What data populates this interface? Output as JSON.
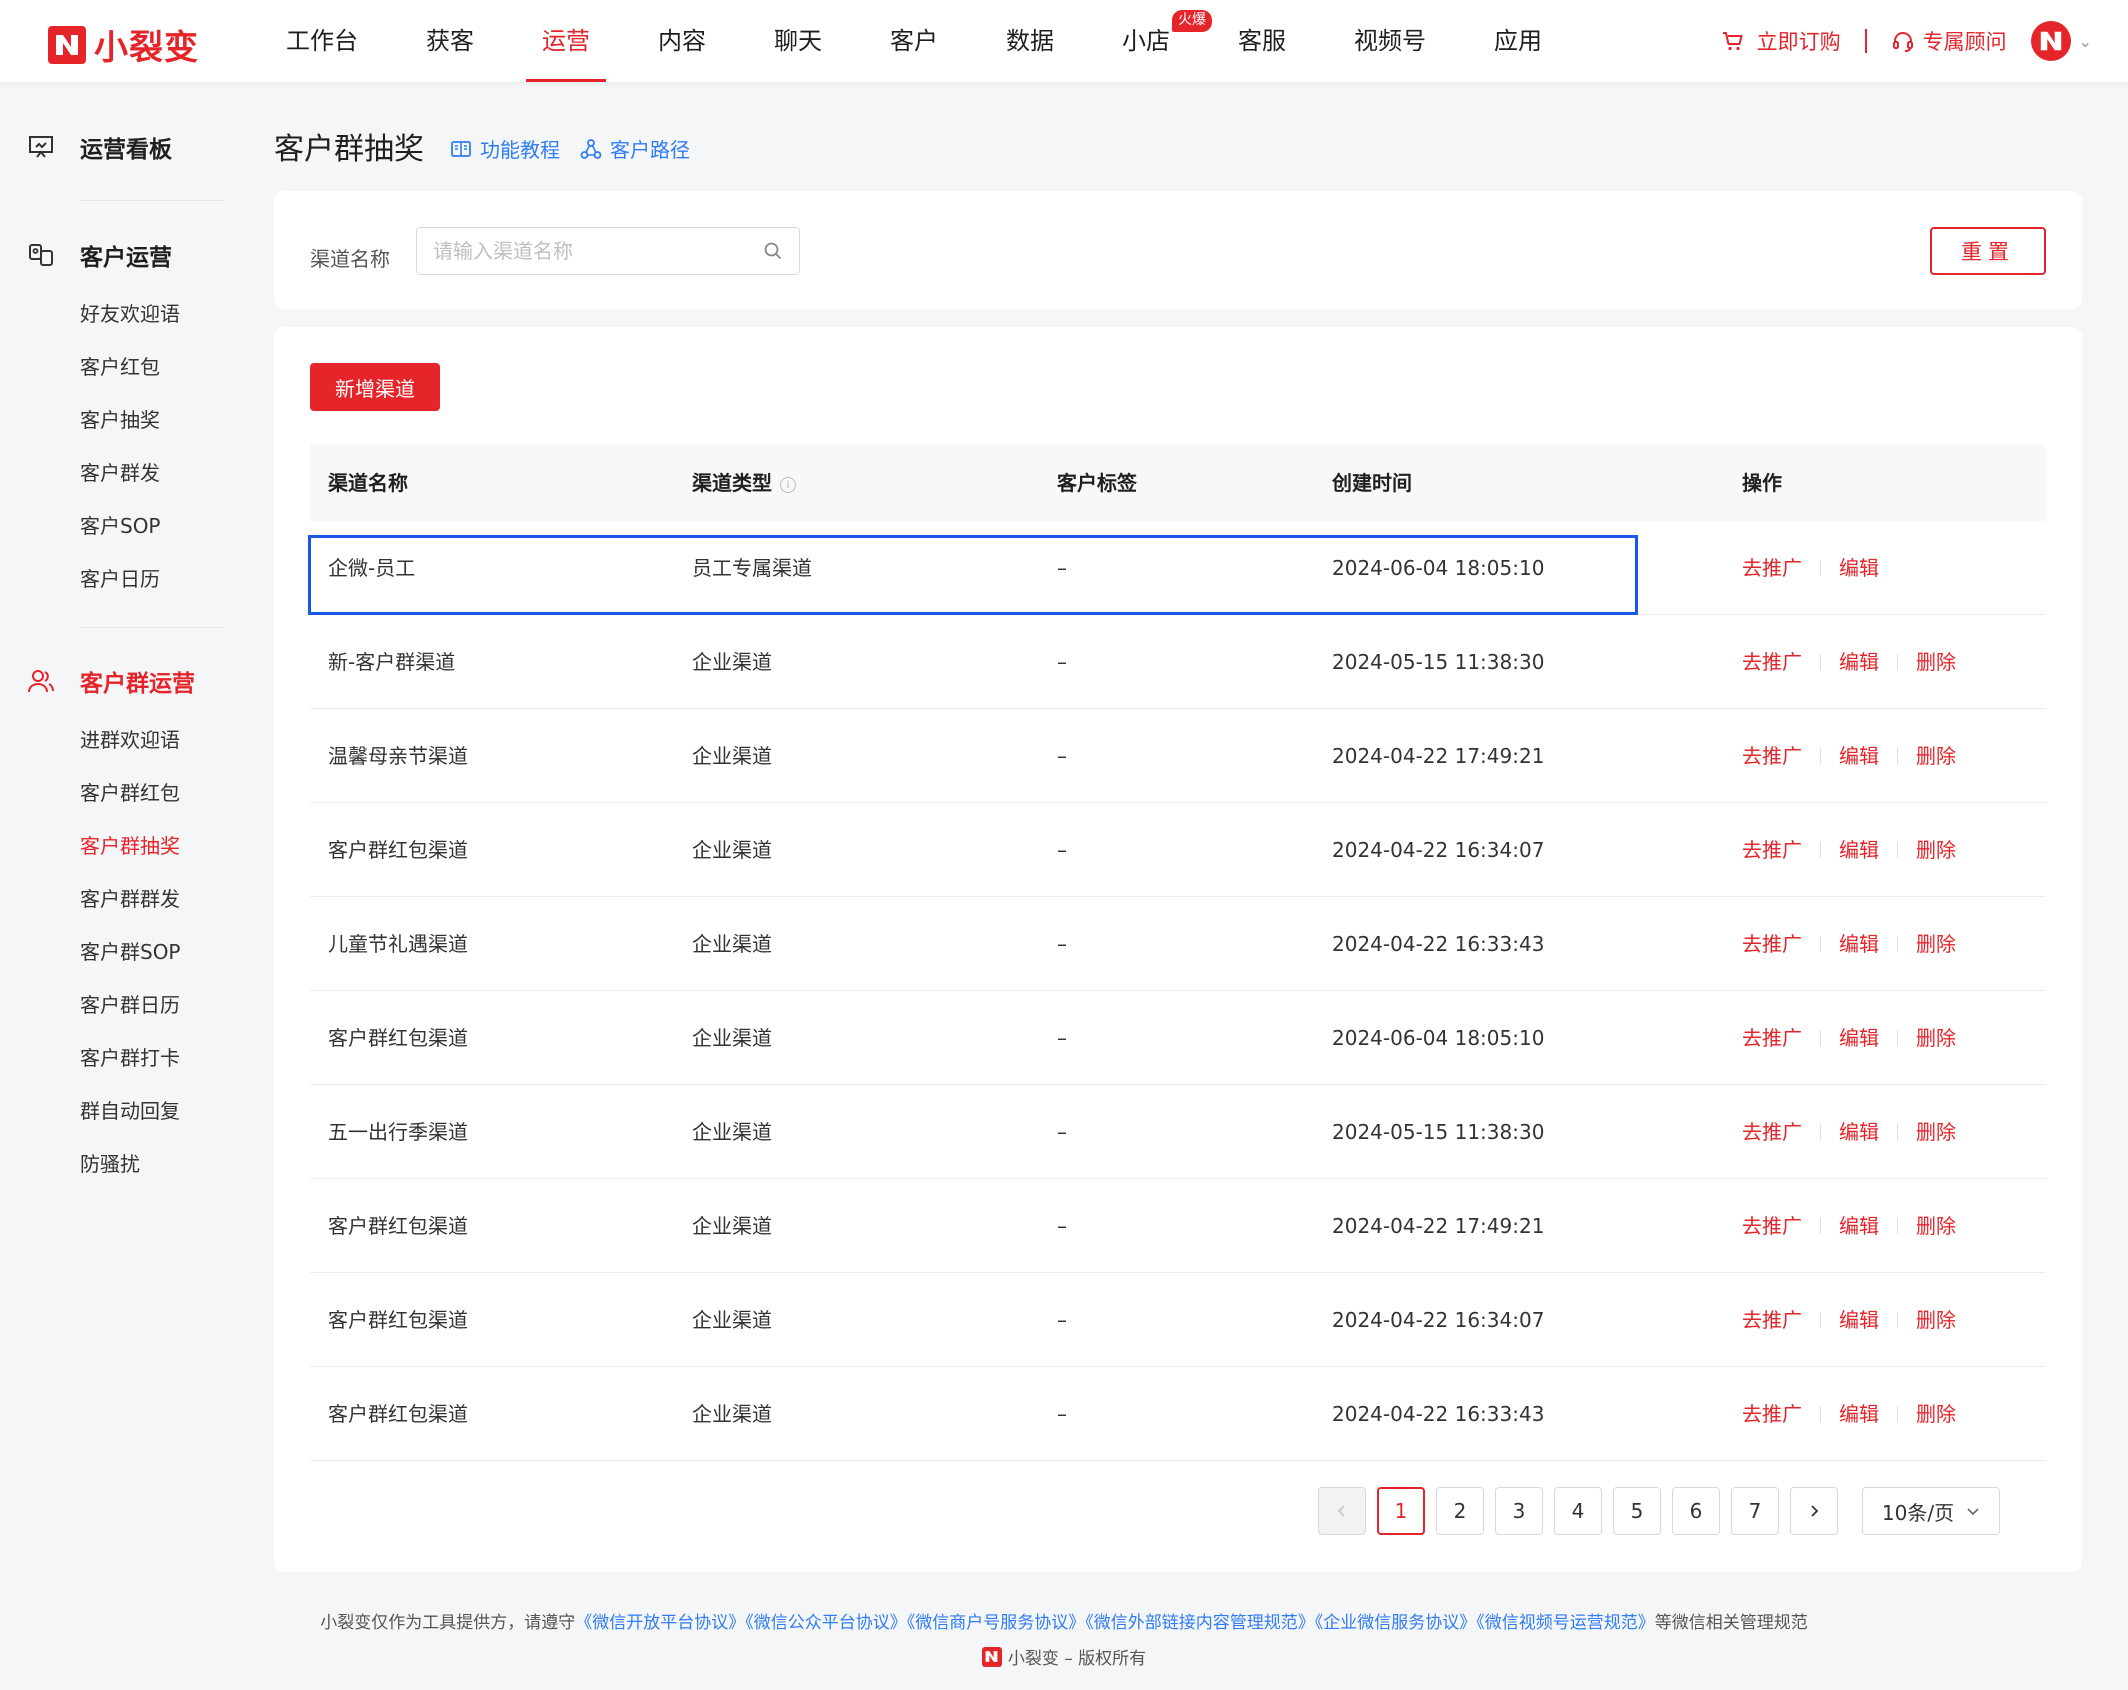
{
  "brand": {
    "name": "小裂变",
    "color": "#e5252a"
  },
  "nav": {
    "items": [
      {
        "label": "工作台"
      },
      {
        "label": "获客"
      },
      {
        "label": "运营",
        "active": true
      },
      {
        "label": "内容"
      },
      {
        "label": "聊天"
      },
      {
        "label": "客户"
      },
      {
        "label": "数据"
      },
      {
        "label": "小店",
        "badge": "火爆"
      },
      {
        "label": "客服"
      },
      {
        "label": "视频号"
      },
      {
        "label": "应用"
      }
    ],
    "order_label": "立即订购",
    "consultant_label": "专属顾问",
    "order_icon": "cart-icon",
    "consultant_icon": "headset-icon"
  },
  "sidebar": {
    "board": {
      "label": "运营看板",
      "icon": "dashboard-icon"
    },
    "customer_ops": {
      "label": "客户运营",
      "icon": "customer-ops-icon",
      "items": [
        "好友欢迎语",
        "客户红包",
        "客户抽奖",
        "客户群发",
        "客户SOP",
        "客户日历"
      ]
    },
    "group_ops": {
      "label": "客户群运营",
      "icon": "group-users-icon",
      "items": [
        "进群欢迎语",
        "客户群红包",
        "客户群抽奖",
        "客户群群发",
        "客户群SOP",
        "客户群日历",
        "客户群打卡",
        "群自动回复",
        "防骚扰"
      ],
      "active_item": "客户群抽奖"
    }
  },
  "page": {
    "title": "客户群抽奖",
    "tutorial_label": "功能教程",
    "path_label": "客户路径"
  },
  "filter": {
    "label": "渠道名称",
    "placeholder": "请输入渠道名称",
    "reset_label": "重置"
  },
  "actions": {
    "add_label": "新增渠道"
  },
  "table": {
    "headers": [
      "渠道名称",
      "渠道类型",
      "客户标签",
      "创建时间",
      "操作"
    ],
    "op_promote": "去推广",
    "op_edit": "编辑",
    "op_delete": "删除",
    "rows": [
      {
        "name": "企微-员工",
        "type": "员工专属渠道",
        "tag": "–",
        "time": "2024-06-04 18:05:10",
        "deletable": false
      },
      {
        "name": "新-客户群渠道",
        "type": "企业渠道",
        "tag": "–",
        "time": "2024-05-15 11:38:30",
        "deletable": true
      },
      {
        "name": "温馨母亲节渠道",
        "type": "企业渠道",
        "tag": "–",
        "time": "2024-04-22 17:49:21",
        "deletable": true
      },
      {
        "name": "客户群红包渠道",
        "type": "企业渠道",
        "tag": "–",
        "time": "2024-04-22 16:34:07",
        "deletable": true
      },
      {
        "name": "儿童节礼遇渠道",
        "type": "企业渠道",
        "tag": "–",
        "time": "2024-04-22 16:33:43",
        "deletable": true
      },
      {
        "name": "客户群红包渠道",
        "type": "企业渠道",
        "tag": "–",
        "time": "2024-06-04 18:05:10",
        "deletable": true
      },
      {
        "name": "五一出行季渠道",
        "type": "企业渠道",
        "tag": "–",
        "time": "2024-05-15 11:38:30",
        "deletable": true
      },
      {
        "name": "客户群红包渠道",
        "type": "企业渠道",
        "tag": "–",
        "time": "2024-04-22 17:49:21",
        "deletable": true
      },
      {
        "name": "客户群红包渠道",
        "type": "企业渠道",
        "tag": "–",
        "time": "2024-04-22 16:34:07",
        "deletable": true
      },
      {
        "name": "客户群红包渠道",
        "type": "企业渠道",
        "tag": "–",
        "time": "2024-04-22 16:33:43",
        "deletable": true
      }
    ]
  },
  "pagination": {
    "pages": [
      "1",
      "2",
      "3",
      "4",
      "5",
      "6",
      "7"
    ],
    "current": "1",
    "page_size_label": "10条/页"
  },
  "footer": {
    "prefix": "小裂变仅作为工具提供方，请遵守",
    "agreements": [
      "《微信开放平台协议》",
      "《微信公众平台协议》",
      "《微信商户号服务协议》",
      "《微信外部链接内容管理规范》",
      "《企业微信服务协议》",
      "《微信视频号运营规范》"
    ],
    "suffix": "等微信相关管理规范",
    "copyright": "小裂变 – 版权所有"
  }
}
